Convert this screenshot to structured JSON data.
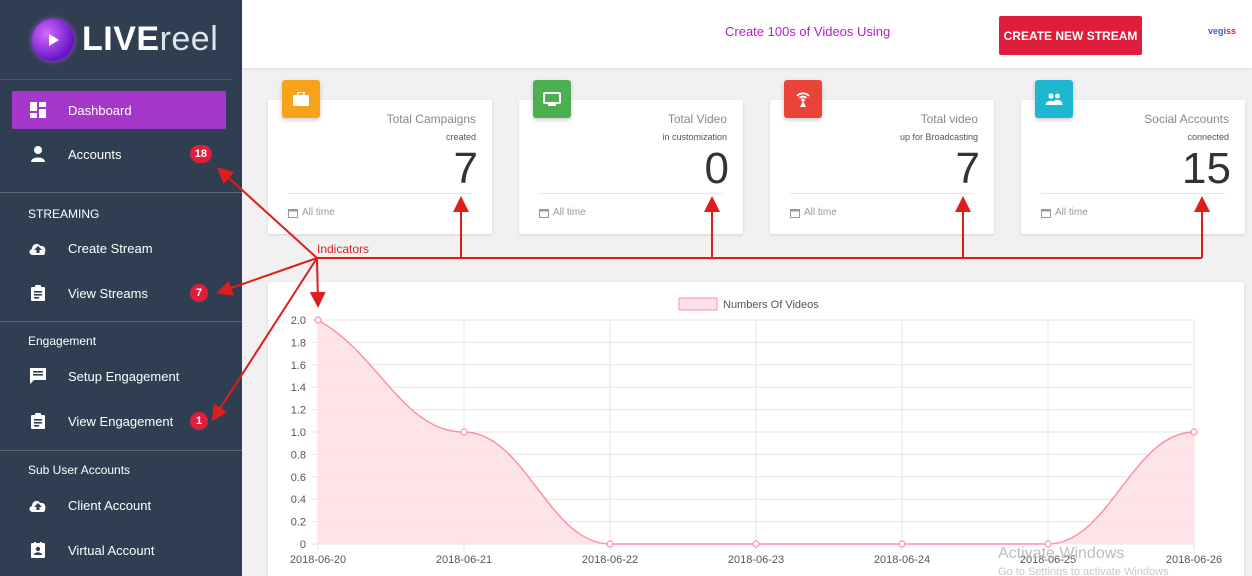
{
  "sidebar": {
    "logo": {
      "live": "LIVE",
      "reel": "reel"
    },
    "items": [
      {
        "label": "Dashboard"
      },
      {
        "label": "Accounts",
        "badge": "18"
      },
      {
        "label": "Create Stream"
      },
      {
        "label": "View Streams",
        "badge": "7"
      },
      {
        "label": "Setup Engagement"
      },
      {
        "label": "View Engagement",
        "badge": "1"
      },
      {
        "label": "Client Account"
      },
      {
        "label": "Virtual Account"
      }
    ],
    "sections": [
      "STREAMING",
      "Engagement",
      "Sub User Accounts"
    ]
  },
  "header": {
    "marquee": "Create 100s of Videos Using",
    "create_button": "CREATE NEW STREAM",
    "brand": {
      "a": "vegi",
      "b": "ss"
    }
  },
  "cards": [
    {
      "title": "Total Campaigns",
      "sub": "created",
      "value": "7",
      "foot": "All time",
      "color": "#f7a21b",
      "icon": "briefcase-icon"
    },
    {
      "title": "Total Video",
      "sub": "in customization",
      "value": "0",
      "foot": "All time",
      "color": "#4caf50",
      "icon": "monitor-icon"
    },
    {
      "title": "Total video",
      "sub": "up for Broadcasting",
      "value": "7",
      "foot": "All time",
      "color": "#e8443a",
      "icon": "broadcast-icon"
    },
    {
      "title": "Social Accounts",
      "sub": "connected",
      "value": "15",
      "foot": "All time",
      "color": "#1fb6d2",
      "icon": "people-icon"
    }
  ],
  "annotation": {
    "label": "Indicators"
  },
  "chart_data": {
    "type": "area",
    "categories": [
      "2018-06-20",
      "2018-06-21",
      "2018-06-22",
      "2018-06-23",
      "2018-06-24",
      "2018-06-25",
      "2018-06-26"
    ],
    "series": [
      {
        "name": "Numbers Of Videos",
        "values": [
          2,
          1,
          0,
          0,
          0,
          0,
          1
        ]
      }
    ],
    "ylim": [
      0,
      2
    ],
    "yticks": [
      "0",
      "0.2",
      "0.4",
      "0.6",
      "0.8",
      "1.0",
      "1.2",
      "1.4",
      "1.6",
      "1.8",
      "2.0"
    ],
    "grid": true,
    "legend": "top-center",
    "colors": {
      "line": "#ff8fa3",
      "fill": "#fde1e6"
    }
  },
  "watermark": {
    "line1": "Activate Windows",
    "line2": "Go to Settings to activate Windows"
  }
}
